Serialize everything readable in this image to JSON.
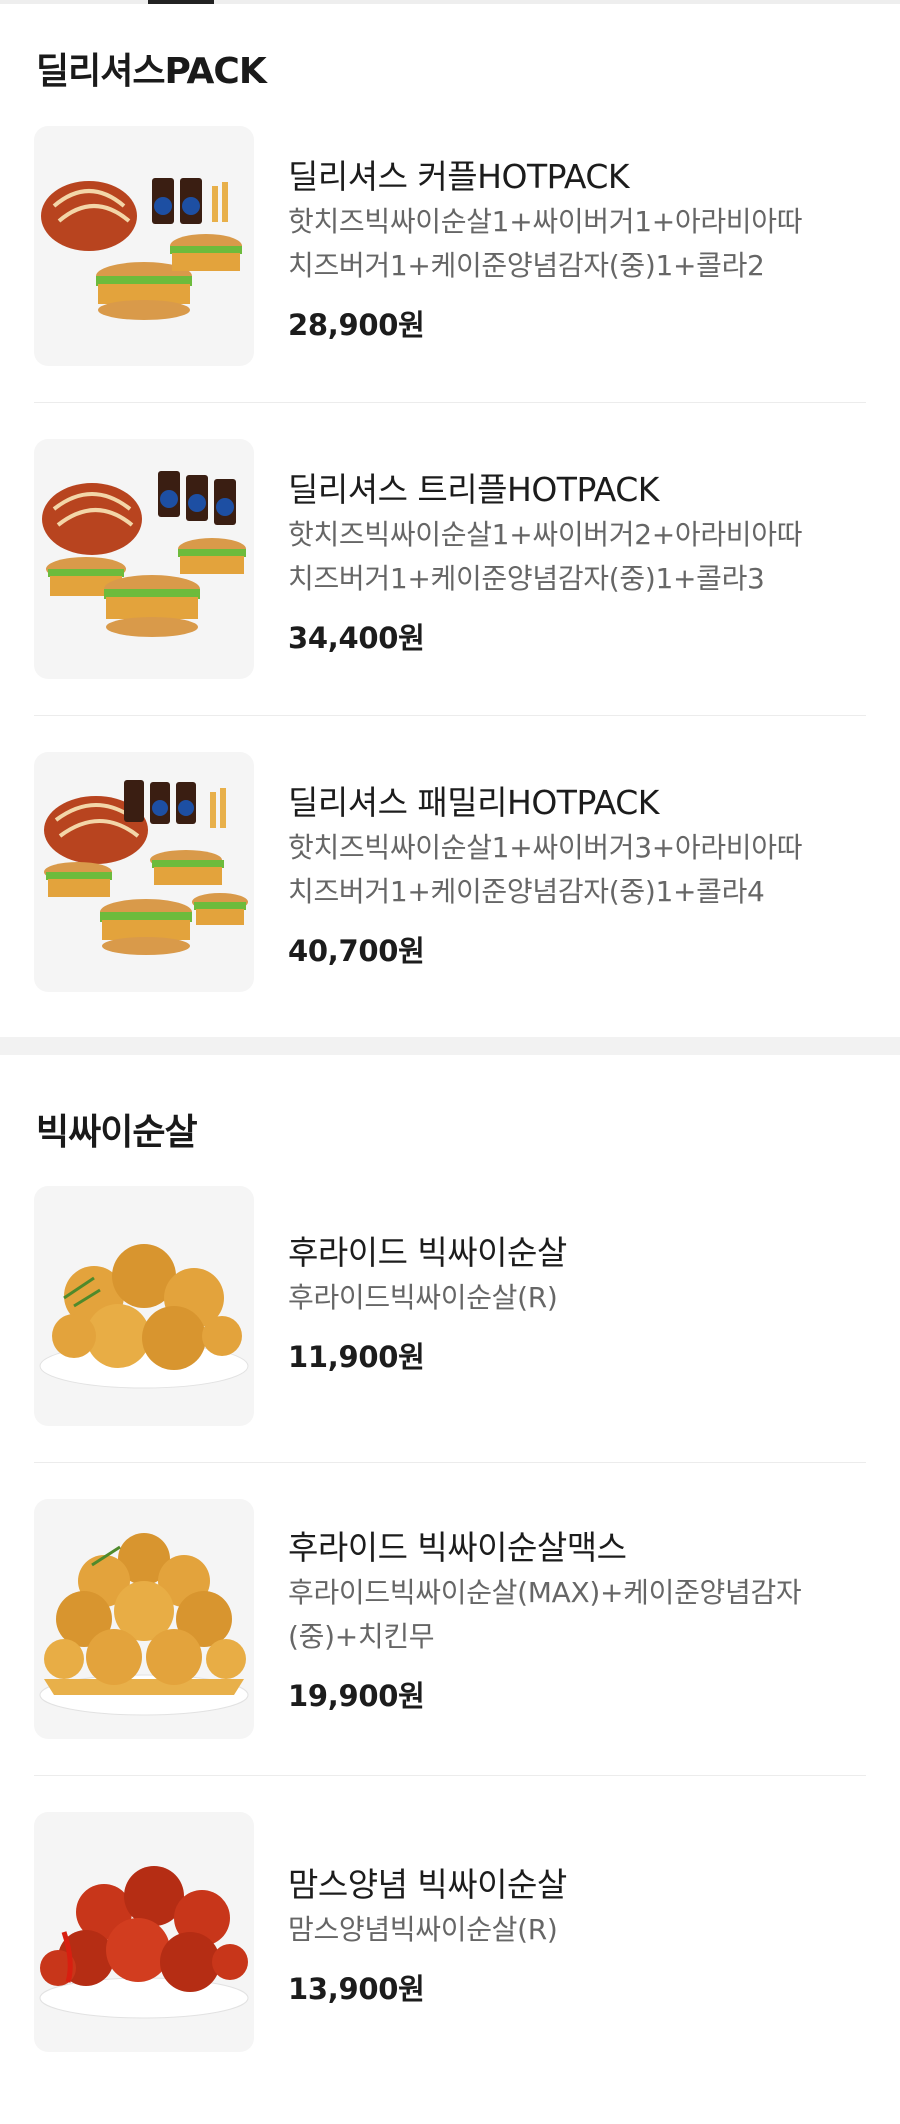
{
  "sections": [
    {
      "title": "딜리셔스PACK",
      "items": [
        {
          "name": "딜리셔스 커플HOTPACK",
          "desc_lines": [
            "핫치즈빅싸이순살1+싸이버거1+아라비아따",
            "치즈버거1+케이준양념감자(중)1+콜라2"
          ],
          "price": "28,900원",
          "image": "couple-hotpack-photo"
        },
        {
          "name": "딜리셔스 트리플HOTPACK",
          "desc_lines": [
            "핫치즈빅싸이순살1+싸이버거2+아라비아따",
            "치즈버거1+케이준양념감자(중)1+콜라3"
          ],
          "price": "34,400원",
          "image": "triple-hotpack-photo"
        },
        {
          "name": "딜리셔스 패밀리HOTPACK",
          "desc_lines": [
            "핫치즈빅싸이순살1+싸이버거3+아라비아따",
            "치즈버거1+케이준양념감자(중)1+콜라4"
          ],
          "price": "40,700원",
          "image": "family-hotpack-photo"
        }
      ]
    },
    {
      "title": "빅싸이순살",
      "items": [
        {
          "name": "후라이드 빅싸이순살",
          "desc_lines": [
            "후라이드빅싸이순살(R)"
          ],
          "price": "11,900원",
          "image": "fried-chicken-photo"
        },
        {
          "name": "후라이드 빅싸이순살맥스",
          "desc_lines": [
            "후라이드빅싸이순살(MAX)+케이준양념감자",
            "(중)+치킨무"
          ],
          "price": "19,900원",
          "image": "fried-chicken-max-photo"
        },
        {
          "name": "맘스양념 빅싸이순살",
          "desc_lines": [
            "맘스양념빅싸이순살(R)"
          ],
          "price": "13,900원",
          "image": "seasoned-chicken-photo"
        }
      ]
    }
  ],
  "colors": {
    "fried": "#e3a33c",
    "seasoned": "#c8361a",
    "lettuce": "#6dbb3c",
    "bun": "#d99a4a",
    "pepsi": "#1d4fa3"
  }
}
